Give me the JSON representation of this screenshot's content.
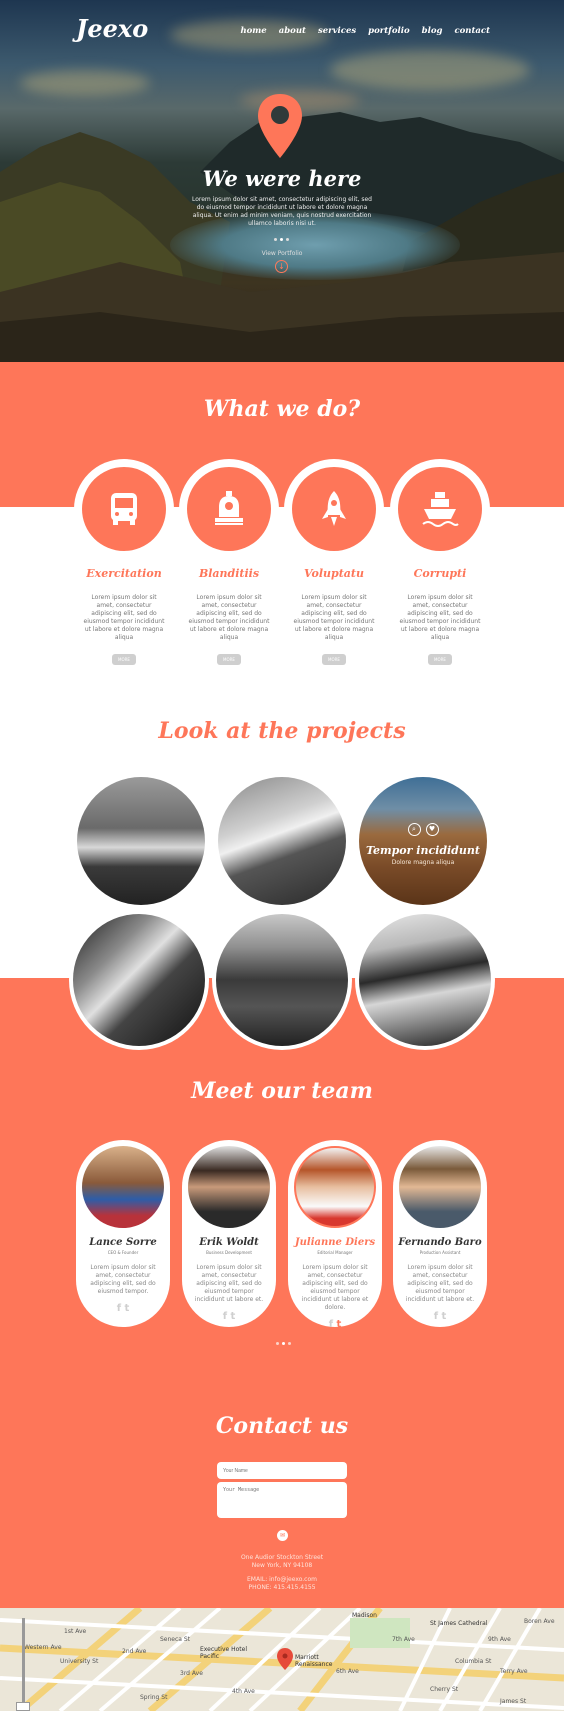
{
  "brand": {
    "logo": "Jeexo"
  },
  "nav": [
    "home",
    "about",
    "services",
    "portfolio",
    "blog",
    "contact"
  ],
  "hero": {
    "title": "We were here",
    "text": "Lorem ipsum dolor sit amet, consectetur adipiscing elit, sed do eiusmod tempor incididunt ut labore et dolore magna aliqua. Ut enim ad minim veniam, quis nostrud exercitation ullamco laboris nisi ut.",
    "link": "View Portfolio"
  },
  "services": {
    "title": "What we do?",
    "items": [
      {
        "name": "Exercitation",
        "icon": "bus-icon",
        "text": "Lorem ipsum dolor sit amet, consectetur adipiscing elit, sed do eiusmod tempor incididunt ut labore et dolore magna aliqua",
        "button": "MORE"
      },
      {
        "name": "Blanditiis",
        "icon": "train-icon",
        "text": "Lorem ipsum dolor sit amet, consectetur adipiscing elit, sed do eiusmod tempor incididunt ut labore et dolore magna aliqua",
        "button": "MORE"
      },
      {
        "name": "Voluptatu",
        "icon": "rocket-icon",
        "text": "Lorem ipsum dolor sit amet, consectetur adipiscing elit, sed do eiusmod tempor incididunt ut labore et dolore magna aliqua",
        "button": "MORE"
      },
      {
        "name": "Corrupti",
        "icon": "ship-icon",
        "text": "Lorem ipsum dolor sit amet, consectetur adipiscing elit, sed do eiusmod tempor incididunt ut labore et dolore magna aliqua",
        "button": "MORE"
      }
    ]
  },
  "projects": {
    "title": "Look at the projects",
    "featured": {
      "title": "Tempor incididunt",
      "subtitle": "Dolore magna aliqua"
    }
  },
  "team": {
    "title": "Meet our team",
    "members": [
      {
        "name": "Lance Sorre",
        "role": "CEO & Founder",
        "text": "Lorem ipsum dolor sit amet, consectetur adipiscing elit, sed do eiusmod tempor."
      },
      {
        "name": "Erik Woldt",
        "role": "Business Development",
        "text": "Lorem ipsum dolor sit amet, consectetur adipiscing elit, sed do eiusmod tempor incididunt ut labore et."
      },
      {
        "name": "Julianne Diers",
        "role": "Editorial Manager",
        "text": "Lorem ipsum dolor sit amet, consectetur adipiscing elit, sed do eiusmod tempor incididunt ut labore et dolore."
      },
      {
        "name": "Fernando Baro",
        "role": "Production Assistant",
        "text": "Lorem ipsum dolor sit amet, consectetur adipiscing elit, sed do eiusmod tempor incididunt ut labore et."
      }
    ]
  },
  "contact": {
    "title": "Contact us",
    "name_placeholder": "Your Name",
    "message_placeholder": "Your Message",
    "address1": "One Audior Stockton Street",
    "address2": "New York, NY 94108",
    "email": "EMAIL: info@jeexo.com",
    "phone": "PHONE: 415.415.4155"
  },
  "map": {
    "labels": [
      "Madison",
      "St James Cathedral",
      "Executive Hotel Pacific",
      "Marriott Renaissance",
      "Seneca St",
      "University St",
      "Spring St",
      "Columbia St",
      "Cherry St",
      "James St",
      "1st Ave",
      "2nd Ave",
      "3rd Ave",
      "4th Ave",
      "6th Ave",
      "7th Ave",
      "9th Ave",
      "Terry Ave",
      "Boren Ave",
      "Western Ave"
    ]
  },
  "colors": {
    "accent": "#fe7659",
    "white": "#ffffff",
    "grey_button": "#cfcfcf"
  }
}
